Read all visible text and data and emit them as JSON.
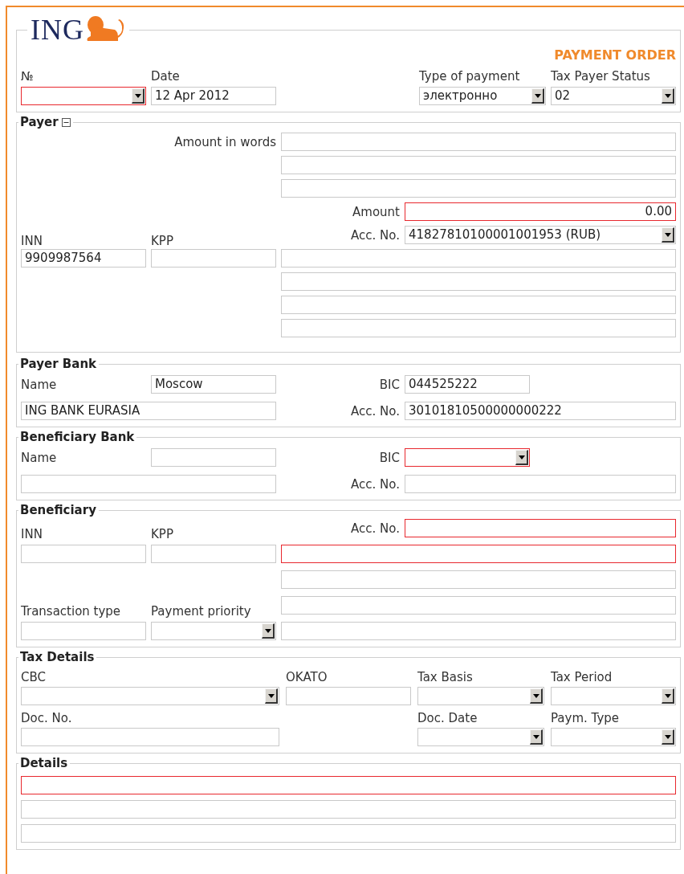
{
  "logo": {
    "text": "ING"
  },
  "title": "PAYMENT ORDER",
  "header": [
    {
      "label": "№",
      "field": {
        "kind": "select",
        "invalid": true
      }
    },
    {
      "label": "Date",
      "field": {
        "kind": "text",
        "invalid": false,
        "value": "12 Apr 2012"
      }
    },
    {
      "label": "Type of payment",
      "field": {
        "kind": "select",
        "invalid": false,
        "value": "электронно"
      }
    },
    {
      "label": "Tax Payer Status",
      "field": {
        "kind": "select",
        "invalid": false,
        "value": "02"
      }
    }
  ],
  "payer": {
    "legend": "Payer",
    "expanded": true,
    "amount_in_words_label": "Amount in words",
    "amount_in_words": [
      {
        "kind": "text",
        "invalid": false
      },
      {
        "kind": "text",
        "invalid": false
      },
      {
        "kind": "text",
        "invalid": false
      }
    ],
    "amount_label": "Amount",
    "amount": {
      "kind": "text",
      "invalid": true,
      "value": "0.00"
    },
    "inn_label": "INN",
    "kpp_label": "KPP",
    "account_label": "Acc. No.",
    "account": {
      "kind": "select",
      "invalid": false,
      "value": "41827810100001001953 (RUB)"
    },
    "inn": {
      "kind": "text",
      "invalid": false,
      "value": "9909987564"
    },
    "kpp": {
      "kind": "text",
      "invalid": false
    },
    "name_lines": [
      {
        "kind": "text",
        "invalid": false
      },
      {
        "kind": "text",
        "invalid": false
      },
      {
        "kind": "text",
        "invalid": false
      },
      {
        "kind": "text",
        "invalid": false
      }
    ]
  },
  "payer_bank": {
    "legend": "Payer Bank",
    "name_label": "Name",
    "city": {
      "kind": "text",
      "invalid": false,
      "value": "Moscow"
    },
    "bic_label": "BIC",
    "bic": {
      "kind": "text",
      "invalid": false,
      "value": "044525222"
    },
    "name": {
      "kind": "text",
      "invalid": false,
      "value": "ING BANK EURASIA"
    },
    "account_label": "Acc. No.",
    "account": {
      "kind": "text",
      "invalid": false,
      "value": "30101810500000000222"
    }
  },
  "beneficiary_bank": {
    "legend": "Beneficiary Bank",
    "name_label": "Name",
    "city": {
      "kind": "text",
      "invalid": false
    },
    "bic_label": "BIC",
    "bic": {
      "kind": "select",
      "invalid": true
    },
    "name": {
      "kind": "text",
      "invalid": false
    },
    "account_label": "Acc. No.",
    "account": {
      "kind": "text",
      "invalid": false
    }
  },
  "beneficiary": {
    "legend": "Beneficiary",
    "account_label": "Acc. No.",
    "account": {
      "kind": "text",
      "invalid": true
    },
    "inn_label": "INN",
    "kpp_label": "KPP",
    "inn": {
      "kind": "text",
      "invalid": false
    },
    "kpp": {
      "kind": "text",
      "invalid": false
    },
    "name_lines": [
      {
        "kind": "text",
        "invalid": true
      },
      {
        "kind": "text",
        "invalid": false
      },
      {
        "kind": "text",
        "invalid": false
      },
      {
        "kind": "text",
        "invalid": false
      }
    ],
    "transaction_type_label": "Transaction type",
    "payment_priority_label": "Payment priority",
    "transaction_type": {
      "kind": "text",
      "invalid": false
    },
    "payment_priority": {
      "kind": "select",
      "invalid": false
    }
  },
  "tax_details": {
    "legend": "Tax Details",
    "items": [
      {
        "label": "CBC",
        "field": {
          "kind": "select",
          "invalid": false
        }
      },
      {
        "label": "OKATO",
        "field": {
          "kind": "text",
          "invalid": false
        }
      },
      {
        "label": "Tax Basis",
        "field": {
          "kind": "select",
          "invalid": false
        }
      },
      {
        "label": "Tax Period",
        "field": {
          "kind": "select",
          "invalid": false
        }
      },
      {
        "label": "Doc. No.",
        "field": {
          "kind": "text",
          "invalid": false
        }
      },
      {
        "label": "Doc. Date",
        "field": {
          "kind": "select",
          "invalid": false
        }
      },
      {
        "label": "Paym. Type",
        "field": {
          "kind": "select",
          "invalid": false
        }
      }
    ]
  },
  "details": {
    "legend": "Details",
    "lines": [
      {
        "kind": "text",
        "invalid": true
      },
      {
        "kind": "text",
        "invalid": false
      },
      {
        "kind": "text",
        "invalid": false
      }
    ]
  }
}
